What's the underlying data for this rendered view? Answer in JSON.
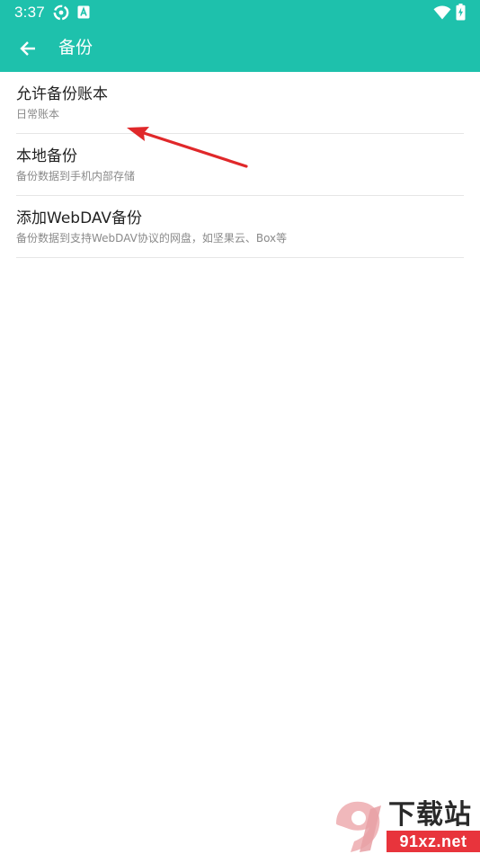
{
  "status_bar": {
    "time": "3:37",
    "icons_left": [
      "sync-icon",
      "a-badge-icon"
    ],
    "icons_right": [
      "wifi-icon",
      "battery-charging-icon"
    ]
  },
  "app_bar": {
    "title": "备份",
    "back_icon": "arrow-back-icon",
    "background": "#1ec1ac"
  },
  "settings": {
    "items": [
      {
        "title": "允许备份账本",
        "subtitle": "日常账本"
      },
      {
        "title": "本地备份",
        "subtitle": "备份数据到手机内部存储"
      },
      {
        "title": "添加WebDAV备份",
        "subtitle": "备份数据到支持WebDAV协议的网盘，如坚果云、Box等"
      }
    ]
  },
  "annotation": {
    "color": "#e0282a"
  },
  "watermark": {
    "title": "下载站",
    "url": "91xz.net",
    "accent": "#e8343c"
  }
}
